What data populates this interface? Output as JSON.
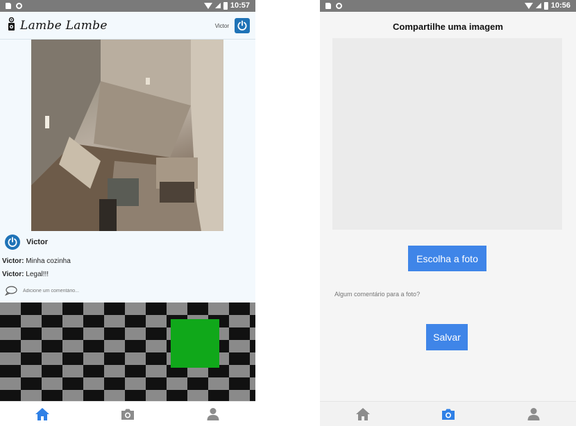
{
  "colors": {
    "accent_blue": "#1f73b7",
    "button_blue": "#3f85e8",
    "status_bar": "#7a7a7a",
    "tab_active": "#2f80e6",
    "tab_inactive": "#8c8c8c",
    "green_square": "#10a81a"
  },
  "left_screen": {
    "status_bar": {
      "time": "10:57"
    },
    "header": {
      "logo_icon": "camera-icon",
      "brand": "Lambe Lambe",
      "user_name": "Victor",
      "logout_icon": "power-icon"
    },
    "post": {
      "author": "Victor",
      "comments": [
        {
          "user": "Victor:",
          "text": "Minha cozinha"
        },
        {
          "user": "Victor:",
          "text": "Legal!!!"
        }
      ],
      "add_comment_placeholder": "Adicione um comentário..."
    },
    "tabs": [
      {
        "icon": "home-icon",
        "active": true
      },
      {
        "icon": "camera-icon",
        "active": false
      },
      {
        "icon": "user-icon",
        "active": false
      }
    ]
  },
  "right_screen": {
    "status_bar": {
      "time": "10:56"
    },
    "title": "Compartilhe uma imagem",
    "choose_button": "Escolha a foto",
    "comment_placeholder": "Algum comentário para a foto?",
    "save_button": "Salvar",
    "tabs": [
      {
        "icon": "home-icon",
        "active": false
      },
      {
        "icon": "camera-icon",
        "active": true
      },
      {
        "icon": "user-icon",
        "active": false
      }
    ]
  }
}
